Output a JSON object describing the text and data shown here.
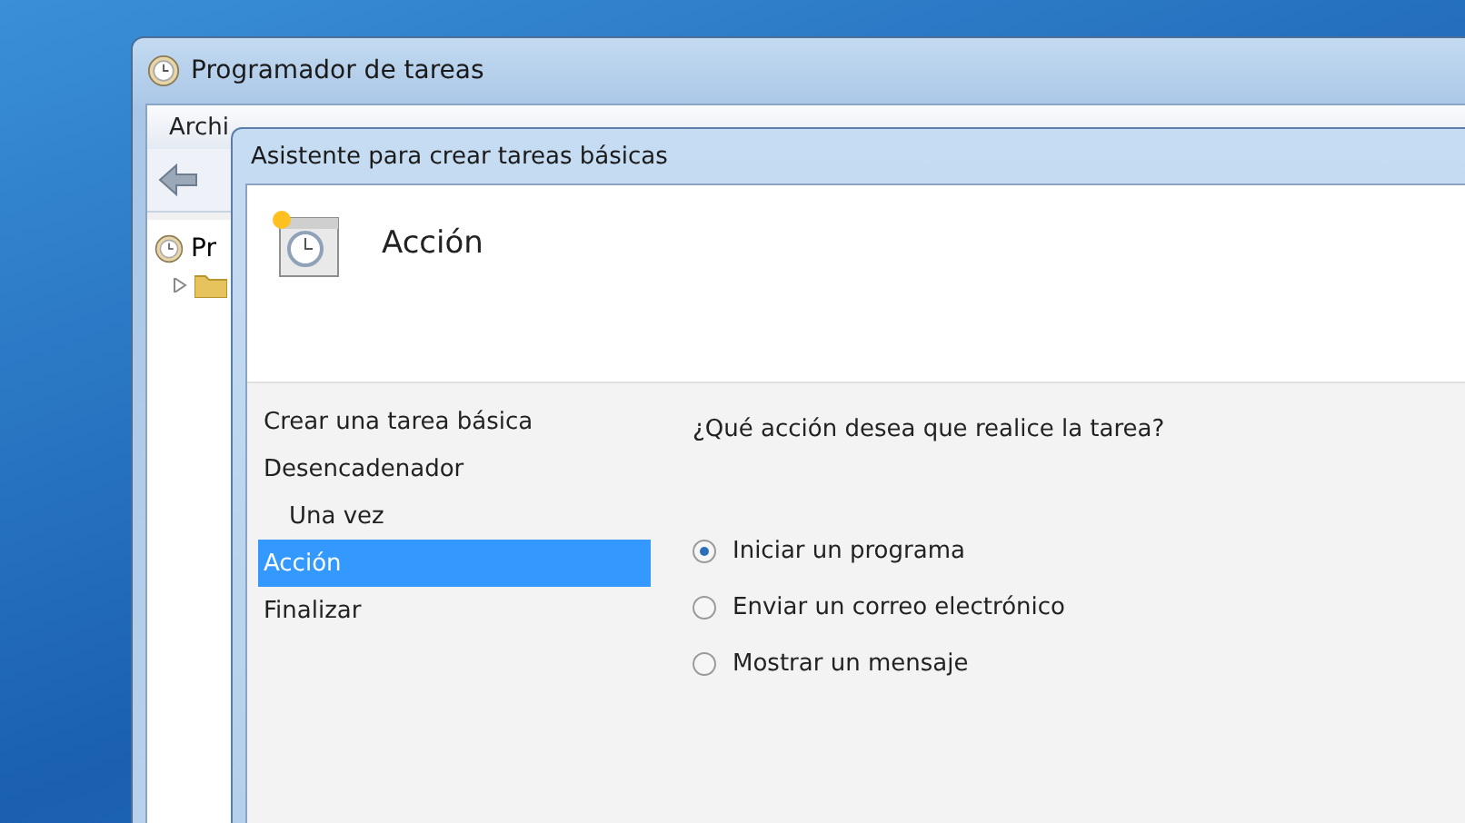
{
  "back_window": {
    "title": "Programador de tareas",
    "menu": [
      "Archi"
    ],
    "tree": [
      {
        "label": "Pr",
        "children": [
          {
            "kind": "folder",
            "expanded": false
          }
        ]
      }
    ]
  },
  "dialog": {
    "title": "Asistente para crear tareas básicas",
    "heading": "Acción",
    "steps": [
      {
        "label": "Crear una tarea básica",
        "selected": false
      },
      {
        "label": "Desencadenador",
        "selected": false,
        "children": [
          {
            "label": "Una vez",
            "selected": false
          }
        ]
      },
      {
        "label": "Acción",
        "selected": true
      },
      {
        "label": "Finalizar",
        "selected": false
      }
    ],
    "question": "¿Qué acción desea que realice la tarea?",
    "options": [
      {
        "label": "Iniciar un programa",
        "selected": true
      },
      {
        "label": "Enviar un correo electrónico",
        "selected": false
      },
      {
        "label": "Mostrar un mensaje",
        "selected": false
      }
    ]
  }
}
